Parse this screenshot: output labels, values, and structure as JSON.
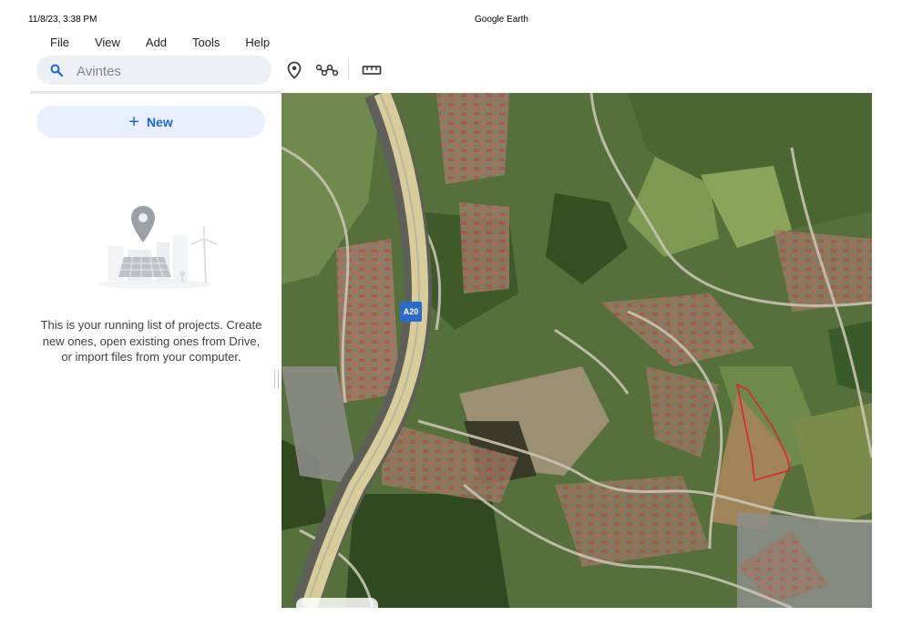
{
  "header": {
    "date": "11/8/23, 3:38 PM",
    "title": "Google Earth"
  },
  "menu": [
    "File",
    "View",
    "Add",
    "Tools",
    "Help"
  ],
  "search": {
    "placeholder": "Avintes",
    "value": ""
  },
  "toolbar": {
    "icons": [
      "placemark-icon",
      "path-icon",
      "ruler-icon"
    ]
  },
  "projects": {
    "new_label": "New",
    "empty_text": "This is your running list of projects. Create new ones, open existing ones from Drive, or import files from your computer."
  },
  "map": {
    "road_label": "A20"
  },
  "colors": {
    "accent": "#1967d2",
    "new_button_bg": "#e8f0fe",
    "search_bg": "#edf0f4",
    "road_shield": "#2a6bd1",
    "boundary": "#e0242c"
  }
}
